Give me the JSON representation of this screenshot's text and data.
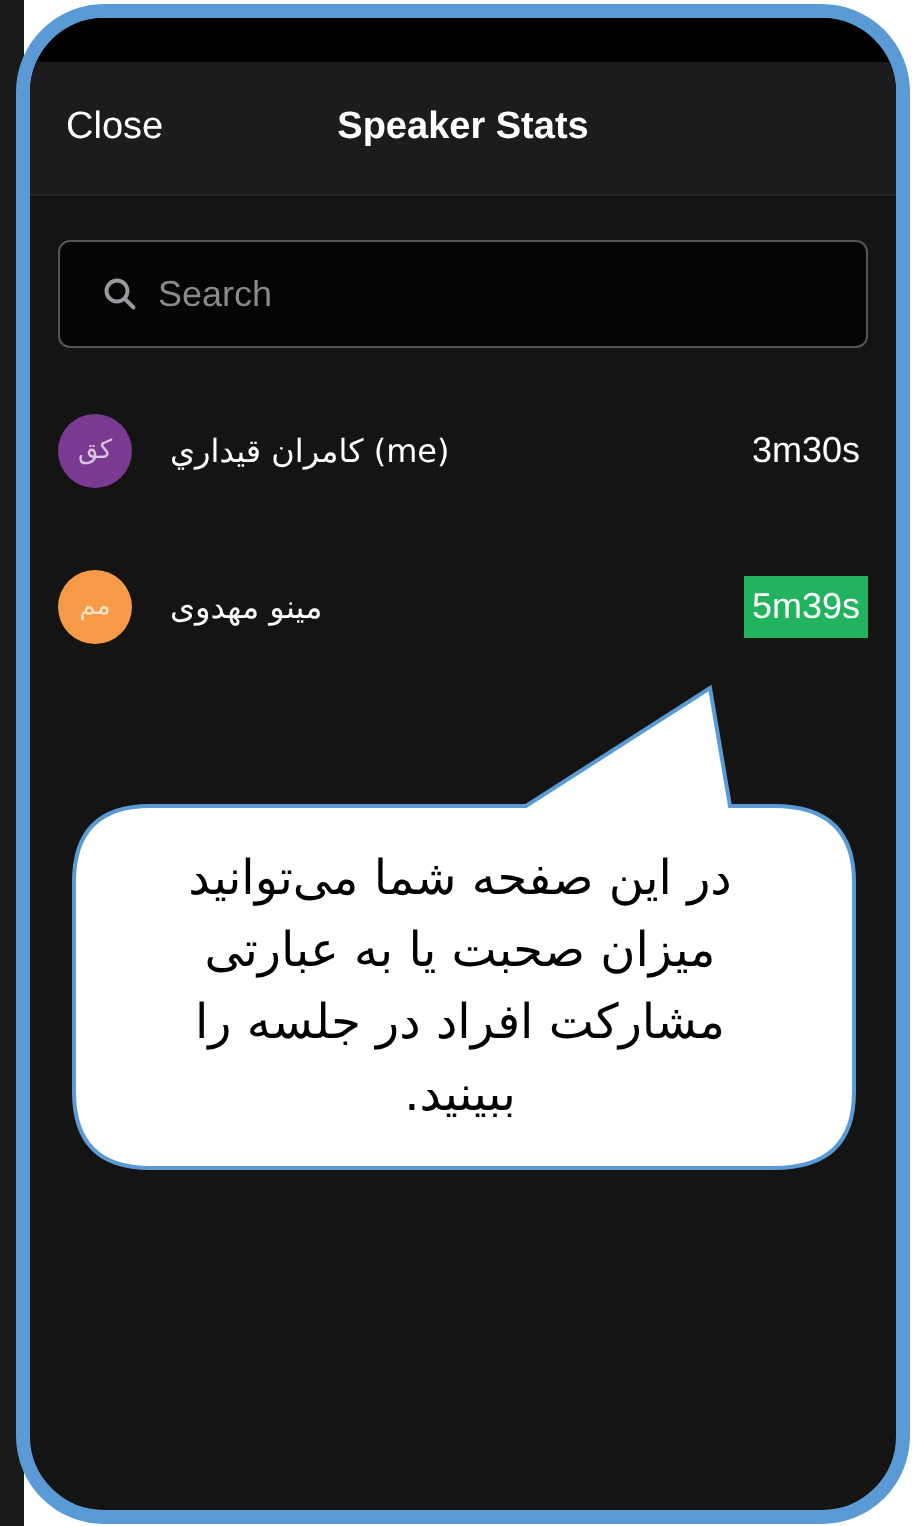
{
  "header": {
    "close": "Close",
    "title": "Speaker Stats"
  },
  "search": {
    "placeholder": "Search"
  },
  "speakers": [
    {
      "initials": "کق",
      "name": "كامران قيداري (me)",
      "color": "#7a3a92",
      "time": "3m30s",
      "highlighted": false
    },
    {
      "initials": "مم",
      "name": "مینو مهدوی",
      "color": "#f79a48",
      "time": "5m39s",
      "highlighted": true
    }
  ],
  "callout": {
    "text": "در این صفحه شما می‌توانید میزان صحبت یا به عبارتی مشارکت افراد در جلسه را ببینید."
  }
}
